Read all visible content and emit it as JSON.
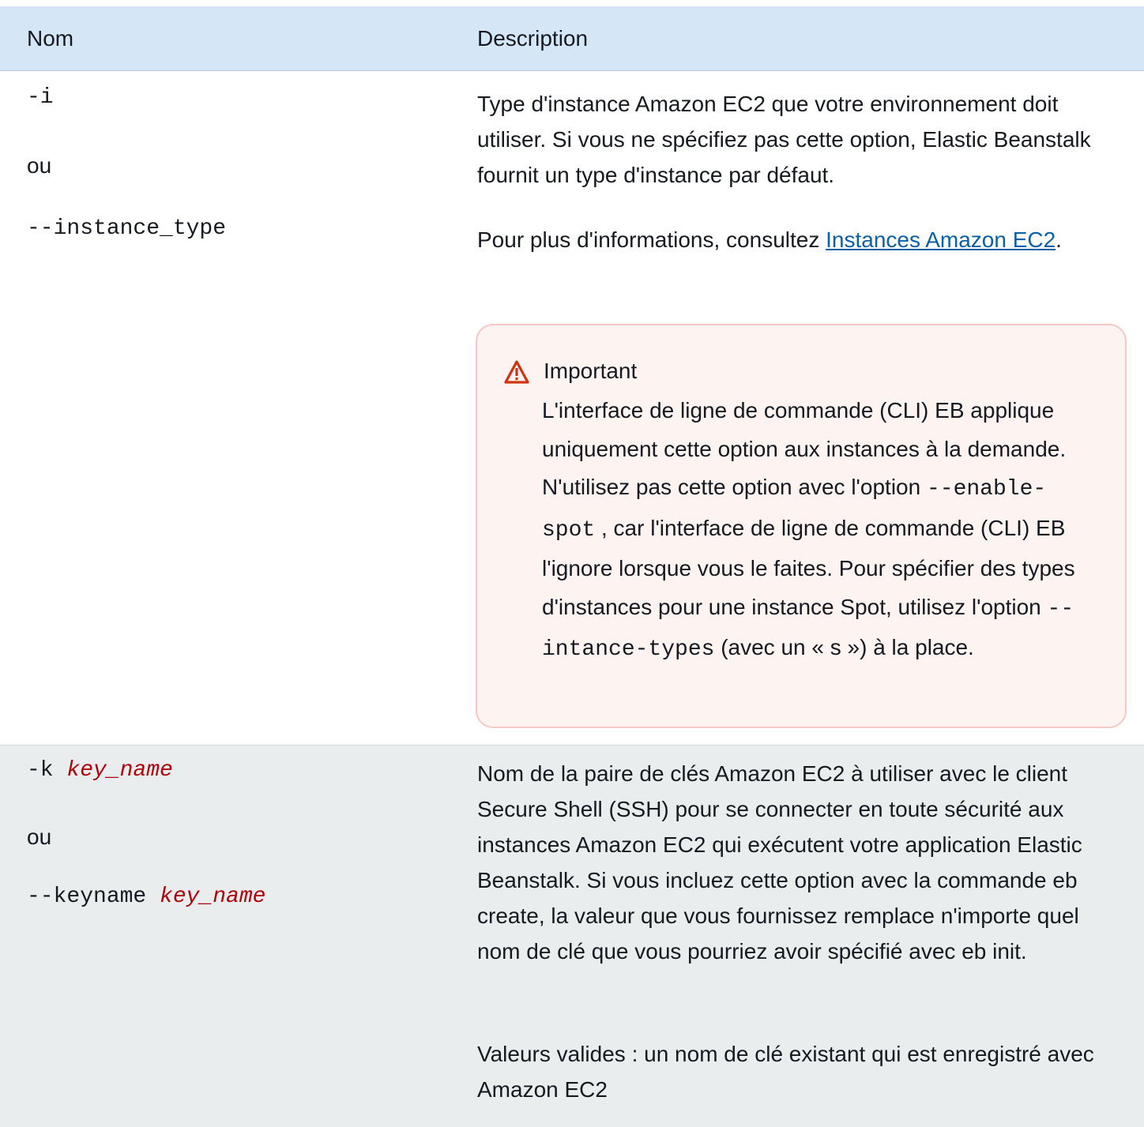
{
  "header": {
    "col_name": "Nom",
    "col_description": "Description"
  },
  "rows": [
    {
      "opt_short": "-i",
      "or": "ou",
      "opt_long": "--instance_type",
      "desc_p1": "Type d'instance Amazon EC2 que votre environnement doit utiliser. Si vous ne spécifiez pas cette option, Elastic Beanstalk fournit un type d'instance par défaut.",
      "desc_p2_prefix": "Pour plus d'informations, consultez ",
      "desc_p2_link": "Instances Amazon EC2",
      "desc_p2_suffix": ".",
      "alert": {
        "icon": "warning-triangle-icon",
        "title": "Important",
        "text_1": "L'interface de ligne de commande (CLI) EB applique uniquement cette option aux instances à la demande. N'utilisez pas cette option avec l'option ",
        "code_1": "--enable-spot",
        "text_2": " , car l'interface de ligne de commande (CLI) EB l'ignore lorsque vous le faites. Pour spécifier des types d'instances pour une instance Spot, utilisez l'option ",
        "code_2": "--intance-types",
        "text_3": " (avec un « s ») à la place."
      }
    },
    {
      "opt_short": "-k",
      "opt_short_arg": "key_name",
      "or": "ou",
      "opt_long": "--keyname",
      "opt_long_arg": "key_name",
      "desc_p1": "Nom de la paire de clés Amazon EC2 à utiliser avec le client Secure Shell (SSH) pour se connecter en toute sécurité aux instances Amazon EC2 qui exécutent votre application Elastic Beanstalk. Si vous incluez cette option avec la commande eb create, la valeur que vous fournissez remplace n'importe quel nom de clé que vous pourriez avoir spécifié avec eb init.",
      "desc_p2": "Valeurs valides : un nom de clé existant qui est enregistré avec Amazon EC2"
    }
  ],
  "colors": {
    "header_bg": "#d5e7f7",
    "row_alt_bg": "#eaeded",
    "alert_bg": "#fdf3f1",
    "alert_border": "#f5c9c4",
    "alert_icon": "#d13212",
    "link": "#0d5fa6",
    "replaceable": "#b0000b"
  }
}
